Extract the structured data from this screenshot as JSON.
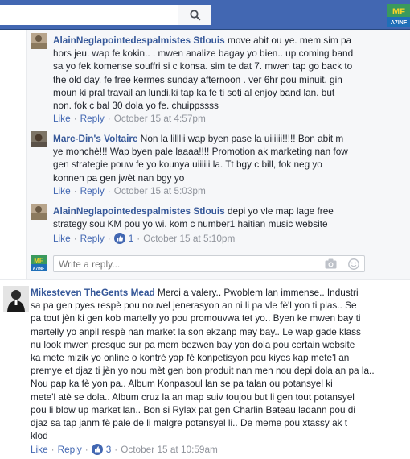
{
  "search": {
    "placeholder": ""
  },
  "top_avatar": {
    "text": "MF\nA7INF"
  },
  "replies": [
    {
      "author": "AlainNeglapointedespalmistes Stlouis",
      "lines": [
        "move abit ou ye. mem sim pa",
        "hors jeu. wap fe kokin.. . mwen analize bagay yo bien.. up coming band",
        "sa yo fek komense souffri si c konsa. sim te dat 7. mwen tap go back to",
        "the old day. fe free kermes sunday afternoon . ver 6hr pou minuit. gin",
        "moun ki pral travail an lundi.ki tap ka fe ti soti al enjoy band lan. but",
        "non. fok c bal 30 dola yo fe. chuippssss"
      ],
      "like_label": "Like",
      "reply_label": "Reply",
      "timestamp": "October 15 at 4:57pm",
      "likes": ""
    },
    {
      "author": "Marc-Din's Voltaire",
      "lines": [
        "Non la lilllii wap byen pase la uiiiiii!!!!! Bon abit m",
        "ye monchè!!! Wap byen pale laaaa!!!! Promotion ak marketing nan fow",
        "gen strategie pouw fe yo kounya uiiiiii la. Tt bgy c bill, fok neg yo",
        "konnen pa gen jwèt nan bgy yo"
      ],
      "like_label": "Like",
      "reply_label": "Reply",
      "timestamp": "October 15 at 5:03pm",
      "likes": ""
    },
    {
      "author": "AlainNeglapointedespalmistes Stlouis",
      "lines": [
        "depi yo vle map lage free",
        "strategy sou KM pou yo wi. kom c number1 haitian music website"
      ],
      "like_label": "Like",
      "reply_label": "Reply",
      "timestamp": "October 15 at 5:10pm",
      "likes": "1"
    }
  ],
  "reply_input": {
    "placeholder": "Write a reply..."
  },
  "main_comment": {
    "author": "Mikesteven TheGents Mead",
    "lines": [
      "Merci a valery.. Pwoblem lan immense.. Industri",
      "sa pa gen pyes respè pou nouvel jenerasyon an ni li pa vle fè'l yon ti plas.. Se",
      "pa tout jèn ki gen kob martelly yo pou promouvwa tet yo.. Byen ke mwen bay ti",
      "martelly yo anpil respè nan market la son ekzanp may bay.. Le wap gade klass",
      "nu look mwen presque sur pa mem bezwen bay yon dola pou certain website",
      "ka mete mizik yo online o kontrè yap fè konpetisyon pou kiyes kap mete'l an",
      "premye et djaz ti jèn yo nou mèt gen bon produit nan men nou depi dola an pa la..",
      "Nou pap ka fè yon pa.. Album Konpasoul lan se pa talan ou potansyel ki",
      "mete'l atè se dola.. Album cruz la an map suiv toujou but li gen tout potansyel",
      "pou li blow up market lan.. Bon si Rylax pat gen Charlin Bateau ladann pou di",
      "djaz sa tap janm fè pale de li malgre potansyel li.. De meme pou xtassy ak t",
      "klod"
    ],
    "like_label": "Like",
    "reply_label": "Reply",
    "timestamp": "October 15 at 10:59am",
    "likes": "3"
  },
  "colors": {
    "topbar": "#4267b2",
    "link": "#365899",
    "meta": "#90949c"
  }
}
